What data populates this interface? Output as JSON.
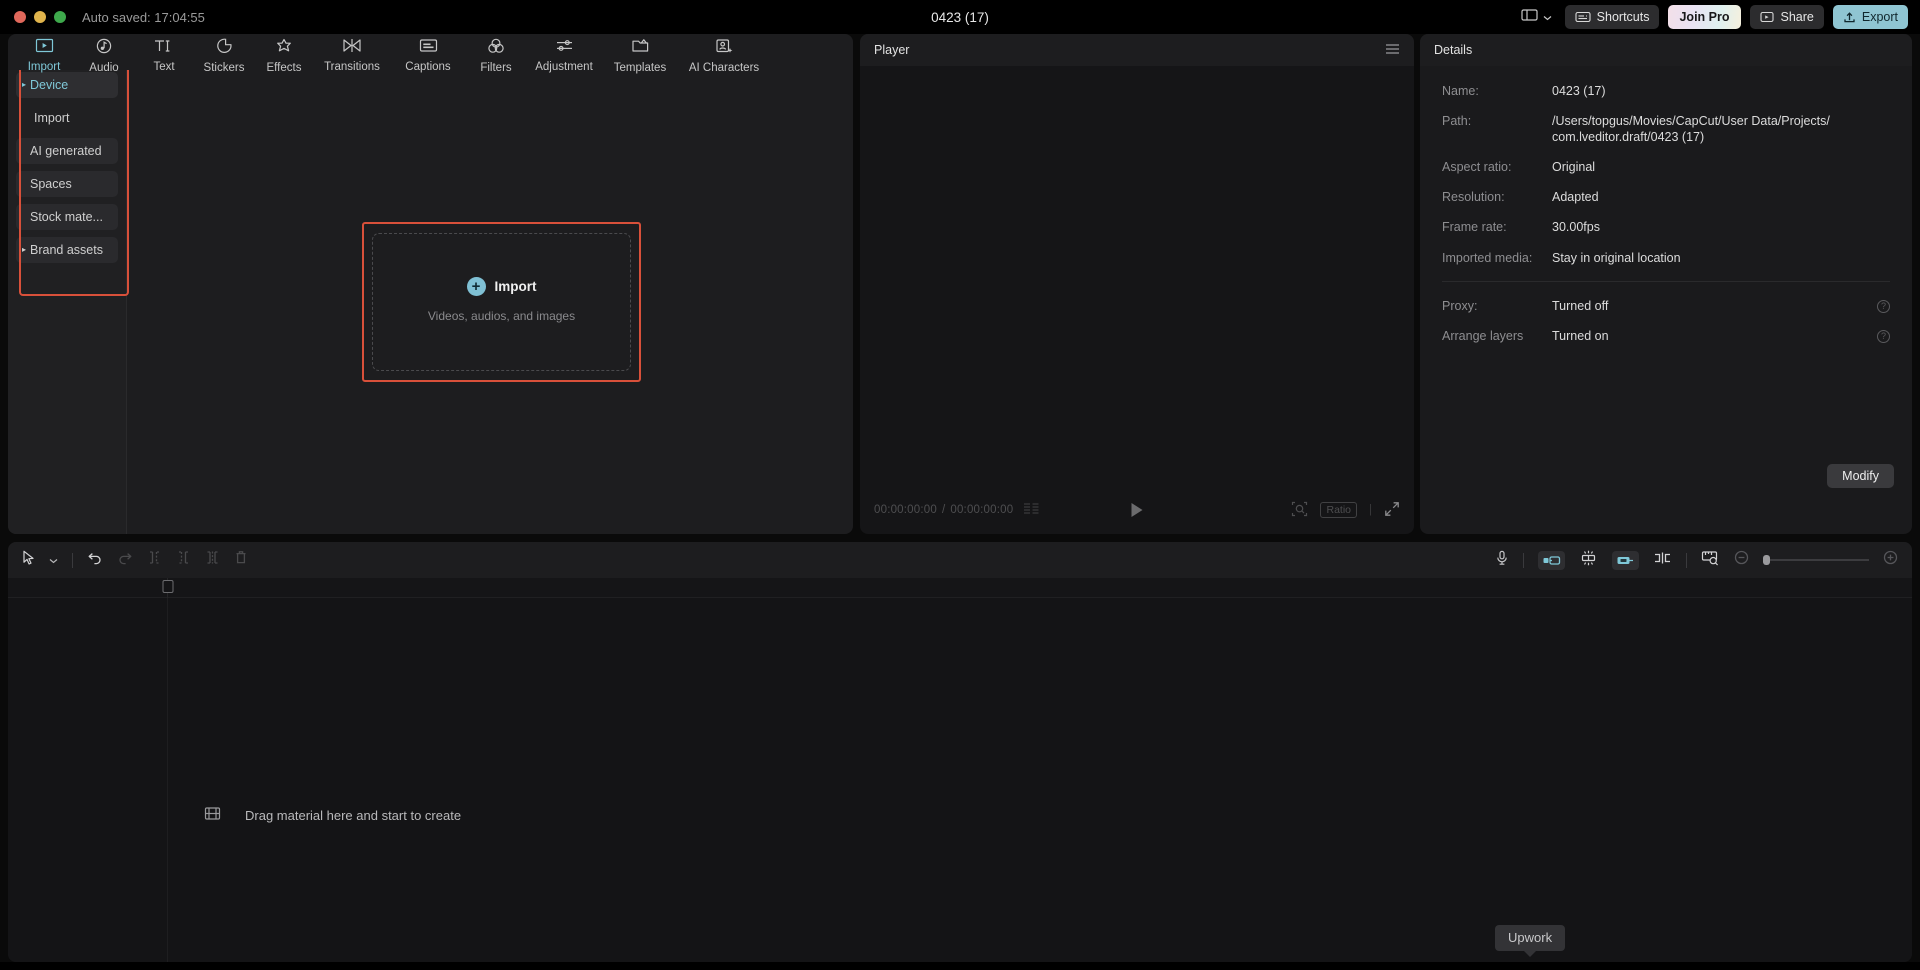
{
  "titlebar": {
    "autosave": "Auto saved: 17:04:55",
    "project_title": "0423 (17)",
    "layout_icon": "layout-panels-icon",
    "chevron_icon": "chevron-down-icon",
    "shortcuts_label": "Shortcuts",
    "shortcuts_icon": "keyboard-icon",
    "join_pro_label": "Join Pro",
    "share_label": "Share",
    "share_icon": "share-video-icon",
    "export_label": "Export",
    "export_icon": "export-upload-icon",
    "accent_export": "#8fc5d2",
    "accent_active": "#7fc8d8"
  },
  "toolbar": {
    "tabs": [
      {
        "label": "Import",
        "icon": "import-media-icon",
        "active": true
      },
      {
        "label": "Audio",
        "icon": "audio-note-icon",
        "active": false
      },
      {
        "label": "Text",
        "icon": "text-ti-icon",
        "active": false
      },
      {
        "label": "Stickers",
        "icon": "sticker-icon",
        "active": false
      },
      {
        "label": "Effects",
        "icon": "effects-sparkle-icon",
        "active": false
      },
      {
        "label": "Transitions",
        "icon": "transitions-bowtie-icon",
        "active": false
      },
      {
        "label": "Captions",
        "icon": "captions-icon",
        "active": false
      },
      {
        "label": "Filters",
        "icon": "filters-circles-icon",
        "active": false
      },
      {
        "label": "Adjustment",
        "icon": "adjustment-sliders-icon",
        "active": false
      },
      {
        "label": "Templates",
        "icon": "templates-folder-icon",
        "active": false
      },
      {
        "label": "AI Characters",
        "icon": "ai-character-icon",
        "active": false
      }
    ]
  },
  "sidebar": {
    "highlight_color": "#d8503a",
    "items": [
      {
        "label": "Device",
        "type": "group",
        "caret": "▸"
      },
      {
        "label": "Import",
        "type": "sub"
      },
      {
        "label": "AI generated",
        "type": "chip"
      },
      {
        "label": "Spaces",
        "type": "chip"
      },
      {
        "label": "Stock mate...",
        "type": "chip"
      },
      {
        "label": "Brand assets",
        "type": "group2",
        "caret": "▸"
      }
    ]
  },
  "dropzone": {
    "plus": "+",
    "title": "Import",
    "subtitle": "Videos, audios, and images",
    "outline_color": "#d8503a"
  },
  "player": {
    "title": "Player",
    "menu_icon": "hamburger-menu-icon",
    "current_time": "00:00:00:00",
    "separator": "/",
    "total_time": "00:00:00:00",
    "play_icon": "play-icon",
    "crop_icon": "crop-magnify-icon",
    "ratio_label": "Ratio",
    "fullscreen_icon": "fullscreen-icon"
  },
  "details": {
    "title": "Details",
    "rows": [
      {
        "key": "Name:",
        "value": "0423 (17)"
      },
      {
        "key": "Path:",
        "value": "/Users/topgus/Movies/CapCut/User Data/Projects/\ncom.lveditor.draft/0423 (17)"
      },
      {
        "key": "Aspect ratio:",
        "value": "Original"
      },
      {
        "key": "Resolution:",
        "value": "Adapted"
      },
      {
        "key": "Frame rate:",
        "value": "30.00fps"
      },
      {
        "key": "Imported media:",
        "value": "Stay in original location"
      }
    ],
    "rows2": [
      {
        "key": "Proxy:",
        "value": "Turned off",
        "help": "?"
      },
      {
        "key": "Arrange layers",
        "value": "Turned on",
        "help": "?"
      }
    ],
    "modify_label": "Modify"
  },
  "timeline": {
    "left_tools": [
      {
        "icon": "select-cursor-icon"
      },
      {
        "icon": "chevron-down-icon"
      },
      {
        "icon": "undo-icon"
      },
      {
        "icon": "redo-icon"
      },
      {
        "icon": "split-left-icon"
      },
      {
        "icon": "split-right-icon"
      },
      {
        "icon": "split-icon"
      },
      {
        "icon": "delete-trash-icon"
      }
    ],
    "right_tools": [
      {
        "icon": "microphone-icon"
      },
      {
        "icon": "keyframe-left-icon"
      },
      {
        "icon": "auto-snap-icon"
      },
      {
        "icon": "keyframe-right-icon"
      },
      {
        "icon": "split-clip-icon"
      },
      {
        "icon": "ruler-zoom-icon"
      },
      {
        "icon": "zoom-out-icon"
      },
      {
        "icon": "zoom-in-icon"
      }
    ],
    "drag_hint": "Drag material here and start to create",
    "drag_icon": "film-strip-icon"
  },
  "tooltip": {
    "upwork_label": "Upwork"
  }
}
